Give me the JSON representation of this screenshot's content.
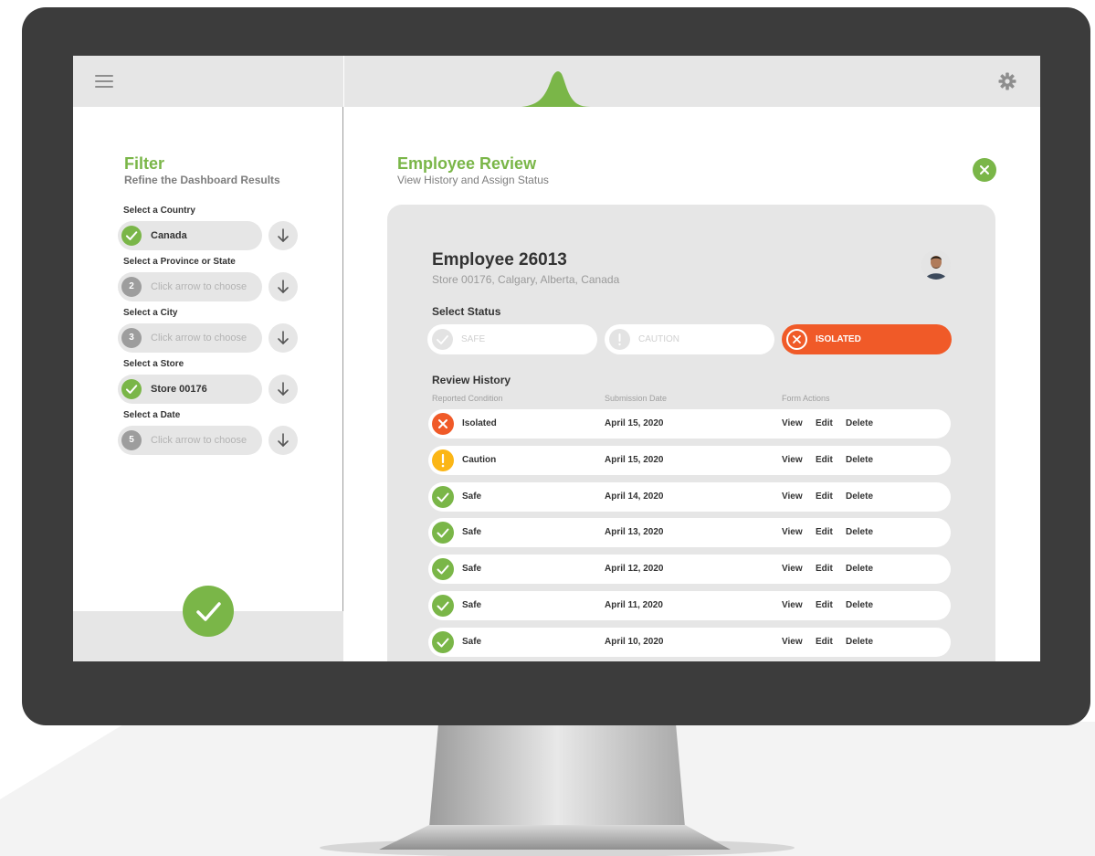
{
  "colors": {
    "brand_green": "#7ab648",
    "isolated_red": "#f05a28",
    "caution_yellow": "#fbb616",
    "panel_grey": "#e6e6e6",
    "bezel": "#3c3c3c"
  },
  "icons": {
    "menu": "hamburger-icon",
    "logo": "mountain-logo",
    "settings": "gear-icon",
    "close": "close-icon",
    "check": "check-icon",
    "down_arrow": "arrow-down-icon",
    "exclamation": "exclamation-icon"
  },
  "filter": {
    "title": "Filter",
    "subtitle": "Refine the Dashboard Results",
    "selectors": [
      {
        "label": "Select a Country",
        "badge": "",
        "value": "Canada",
        "state": "selected"
      },
      {
        "label": "Select a Province or State",
        "badge": "2",
        "value": "Click arrow to choose",
        "state": "empty"
      },
      {
        "label": "Select a City",
        "badge": "3",
        "value": "Click arrow to choose",
        "state": "empty"
      },
      {
        "label": "Select a Store",
        "badge": "",
        "value": "Store 00176",
        "state": "selected"
      },
      {
        "label": "Select a Date",
        "badge": "5",
        "value": "Click arrow to choose",
        "state": "empty"
      }
    ]
  },
  "review": {
    "title": "Employee Review",
    "subtitle": "View History and Assign Status",
    "employee_name": "Employee 26013",
    "employee_store": "Store 00176, Calgary, Alberta, Canada",
    "status_label": "Select Status",
    "status_options": [
      {
        "label": "SAFE",
        "active": false
      },
      {
        "label": "CAUTION",
        "active": false
      },
      {
        "label": "ISOLATED",
        "active": true
      }
    ],
    "history_label": "Review History",
    "columns": [
      "Reported Condition",
      "Submission Date",
      "Form Actions"
    ],
    "actions": [
      "View",
      "Edit",
      "Delete"
    ],
    "rows": [
      {
        "condition": "Isolated",
        "date": "April 15, 2020",
        "kind": "isolated"
      },
      {
        "condition": "Caution",
        "date": "April 15, 2020",
        "kind": "caution"
      },
      {
        "condition": "Safe",
        "date": "April 14, 2020",
        "kind": "safe"
      },
      {
        "condition": "Safe",
        "date": "April 13, 2020",
        "kind": "safe"
      },
      {
        "condition": "Safe",
        "date": "April 12, 2020",
        "kind": "safe"
      },
      {
        "condition": "Safe",
        "date": "April 11, 2020",
        "kind": "safe"
      },
      {
        "condition": "Safe",
        "date": "April 10, 2020",
        "kind": "safe"
      }
    ]
  }
}
